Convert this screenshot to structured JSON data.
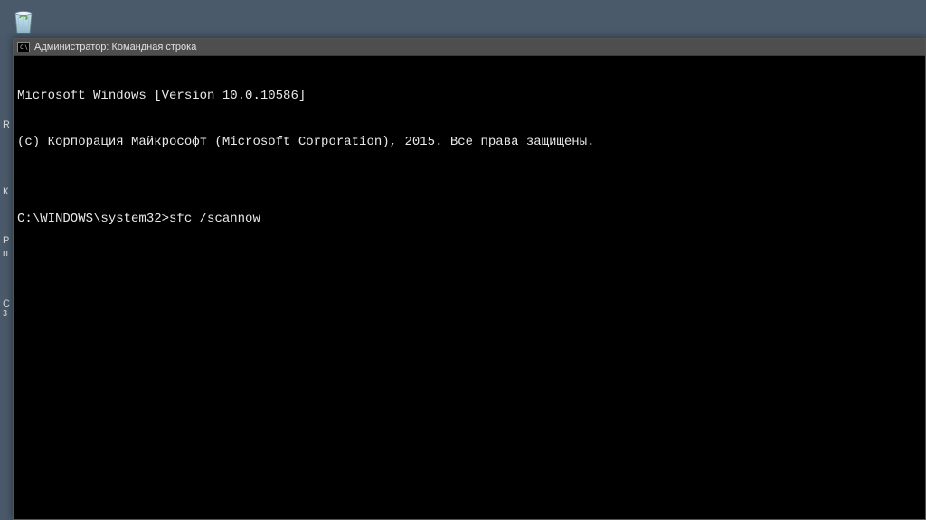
{
  "desktop": {
    "recycle_bin_label": "Корзина",
    "bg_fragments": {
      "r": "R",
      "k": "К",
      "p": "Р\nп",
      "c": "С",
      "z": "з"
    }
  },
  "window": {
    "title": "Администратор: Командная строка",
    "icon_label": "cmd-icon"
  },
  "terminal": {
    "line1": "Microsoft Windows [Version 10.0.10586]",
    "line2": "(c) Корпорация Майкрософт (Microsoft Corporation), 2015. Все права защищены.",
    "blank": "",
    "prompt": "C:\\WINDOWS\\system32>",
    "command": "sfc /scannow"
  }
}
